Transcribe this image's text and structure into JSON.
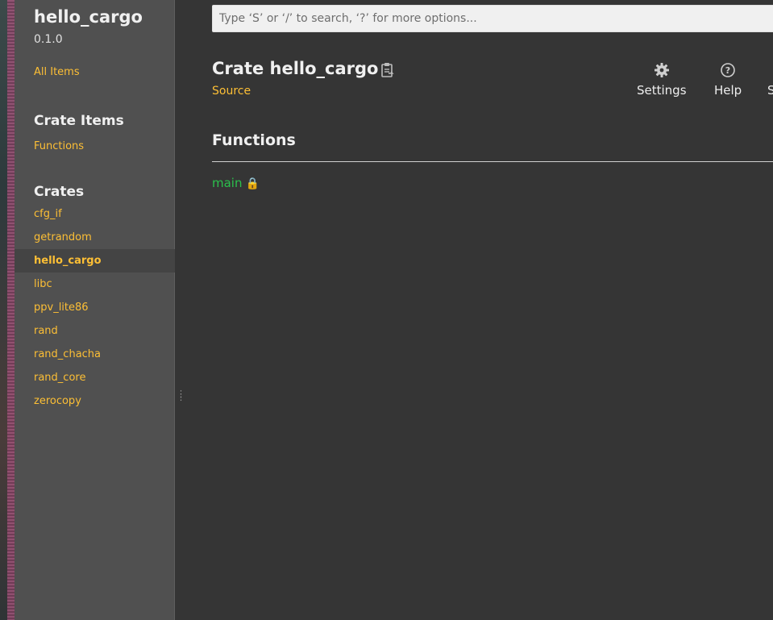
{
  "sidebar": {
    "crate_name": "hello_cargo",
    "version": "0.1.0",
    "all_items_label": "All Items",
    "crate_items_heading": "Crate Items",
    "crate_items": [
      {
        "label": "Functions"
      }
    ],
    "crates_heading": "Crates",
    "crates": [
      {
        "label": "cfg_if"
      },
      {
        "label": "getrandom"
      },
      {
        "label": "hello_cargo",
        "current": true
      },
      {
        "label": "libc"
      },
      {
        "label": "ppv_lite86"
      },
      {
        "label": "rand"
      },
      {
        "label": "rand_chacha"
      },
      {
        "label": "rand_core"
      },
      {
        "label": "zerocopy"
      }
    ]
  },
  "search": {
    "placeholder": "Type ‘S’ or ‘/’ to search, ‘?’ for more options..."
  },
  "main": {
    "title": "Crate hello_cargo",
    "source_label": "Source",
    "toolbar": {
      "settings_label": "Settings",
      "help_label": "Help",
      "summary_label": "S"
    },
    "functions_heading": "Functions",
    "functions": [
      {
        "name": "main",
        "icon": "lock-icon"
      }
    ]
  },
  "colors": {
    "link": "#fdbf35",
    "function": "#2bc04c",
    "sidebar_bg": "#505050",
    "main_bg": "#353535"
  }
}
